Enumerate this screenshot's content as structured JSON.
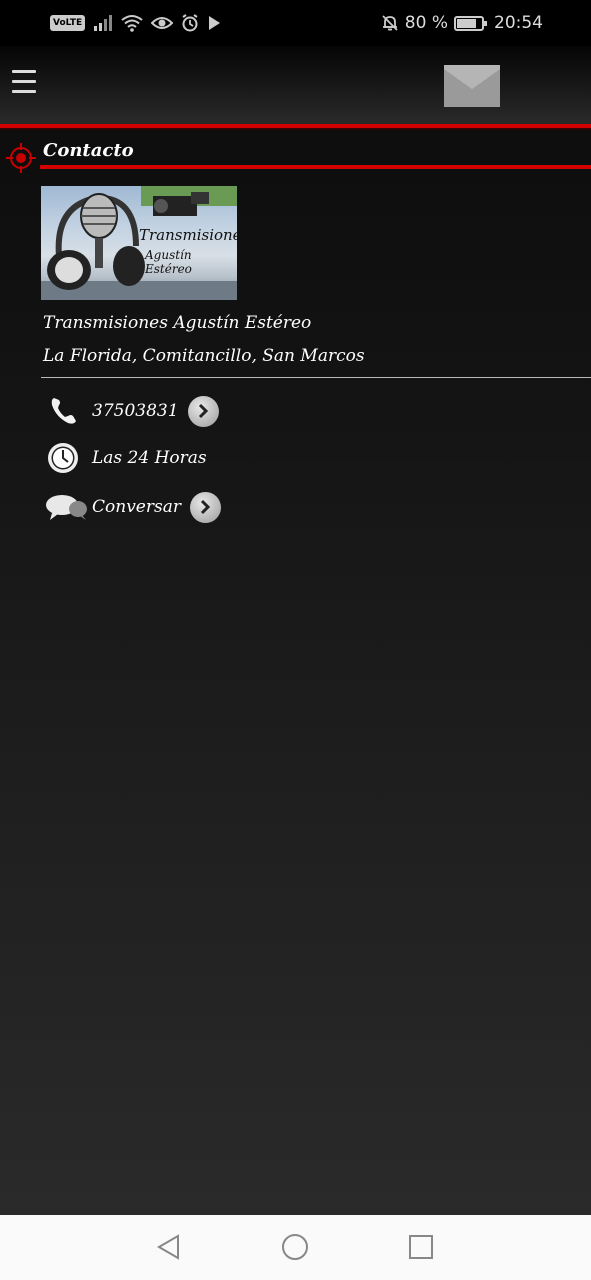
{
  "status_bar": {
    "volte": "VoLTE",
    "battery_percent": "80 %",
    "battery_level": 0.8,
    "time": "20:54"
  },
  "header": {
    "menu_icon": "hamburger-menu-icon",
    "mail_icon": "envelope-icon"
  },
  "section": {
    "title": "Contacto",
    "icon": "target-icon",
    "accent_color": "#d40000"
  },
  "business": {
    "logo_text_line1": "Transmisiones",
    "logo_text_line2": "Agustín Estéreo",
    "name": "Transmisiones Agustín Estéreo",
    "address": "La Florida, Comitancillo, San Marcos"
  },
  "contacts": [
    {
      "icon": "phone-icon",
      "text": "37503831",
      "has_arrow": true
    },
    {
      "icon": "clock-icon",
      "text": "Las 24 Horas",
      "has_arrow": false
    },
    {
      "icon": "chat-bubbles-icon",
      "text": "Conversar",
      "has_arrow": true
    }
  ],
  "nav_bar": {
    "back_icon": "back-triangle-icon",
    "home_icon": "home-circle-icon",
    "recents_icon": "recents-square-icon"
  }
}
